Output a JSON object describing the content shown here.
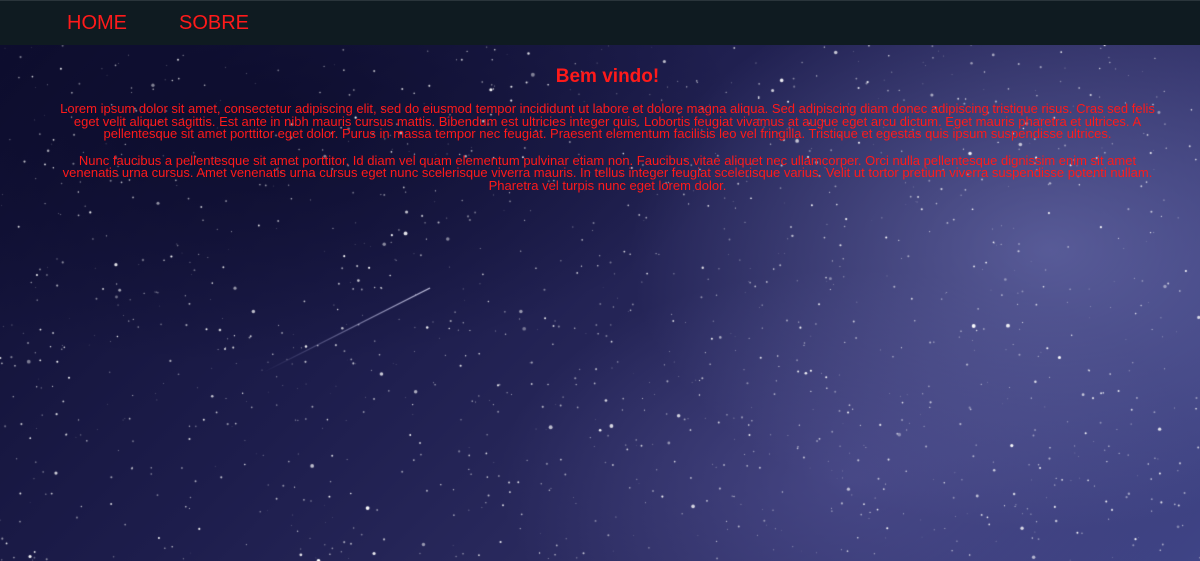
{
  "colors": {
    "text": "#ff1a1a",
    "navbar_bg": "#0f1b21"
  },
  "nav": {
    "items": [
      {
        "label": "HOME"
      },
      {
        "label": "SOBRE"
      }
    ]
  },
  "main": {
    "title": "Bem vindo!",
    "paragraphs": [
      "Lorem ipsum dolor sit amet, consectetur adipiscing elit, sed do eiusmod tempor incididunt ut labore et dolore magna aliqua. Sed adipiscing diam donec adipiscing tristique risus. Cras sed felis eget velit aliquet sagittis. Est ante in nibh mauris cursus mattis. Bibendum est ultricies integer quis. Lobortis feugiat vivamus at augue eget arcu dictum. Eget mauris pharetra et ultrices. A pellentesque sit amet porttitor eget dolor. Purus in massa tempor nec feugiat. Praesent elementum facilisis leo vel fringilla. Tristique et egestas quis ipsum suspendisse ultrices.",
      "Nunc faucibus a pellentesque sit amet porttitor. Id diam vel quam elementum pulvinar etiam non. Faucibus vitae aliquet nec ullamcorper. Orci nulla pellentesque dignissim enim sit amet venenatis urna cursus. Amet venenatis urna cursus eget nunc scelerisque viverra mauris. In tellus integer feugiat scelerisque varius. Velit ut tortor pretium viverra suspendisse potenti nullam. Pharetra vel turpis nunc eget lorem dolor."
    ]
  }
}
